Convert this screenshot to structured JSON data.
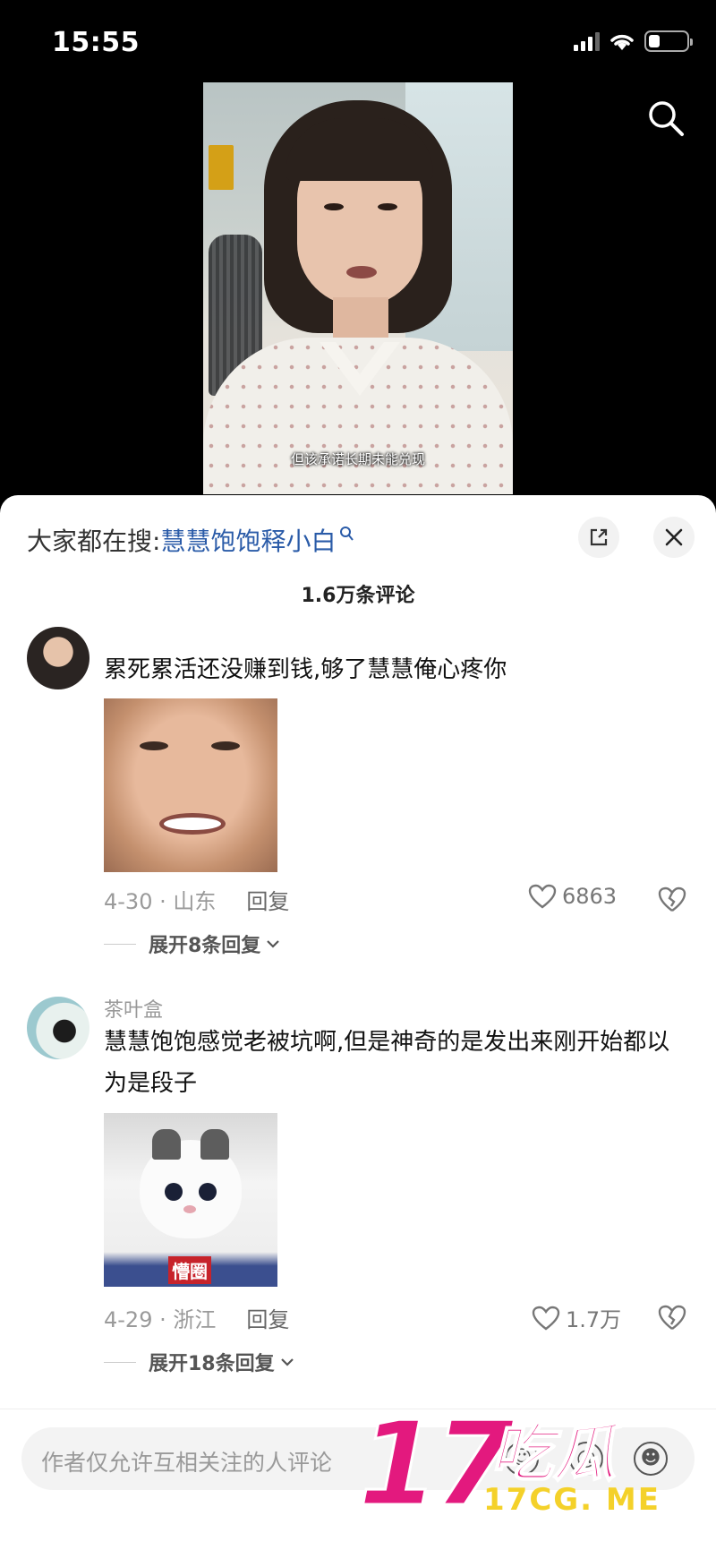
{
  "status_bar": {
    "time": "15:55",
    "battery_level": 0.3
  },
  "video": {
    "subtitle": "但该承诺长期未能兑现"
  },
  "sheet": {
    "hot_search_prefix": "大家都在搜:",
    "hot_search_term": "慧慧饱饱释小白",
    "comment_count": "1.6万条评论"
  },
  "comments": [
    {
      "username": "",
      "text": "累死累活还没赚到钱,够了慧慧俺心疼你",
      "date_location": "4-30 · 山东",
      "reply_label": "回复",
      "likes": "6863",
      "expand_replies": "展开8条回复"
    },
    {
      "username": "茶叶盒",
      "text": "慧慧饱饱感觉老被坑啊,但是神奇的是发出来刚开始都以为是段子",
      "sticker_caption": "懵圈",
      "date_location": "4-29 · 浙江",
      "reply_label": "回复",
      "likes": "1.7万",
      "expand_replies": "展开18条回复"
    }
  ],
  "bottom_bar": {
    "placeholder": "作者仅允许互相关注的人评论",
    "at_symbol": "@"
  },
  "watermark": {
    "number": "17",
    "chinese": "吃瓜",
    "domain": "17CG. ME"
  },
  "colors": {
    "accent_link": "#2a5ba8",
    "watermark_pink": "#e3197e",
    "watermark_yellow": "#f4d12a"
  }
}
